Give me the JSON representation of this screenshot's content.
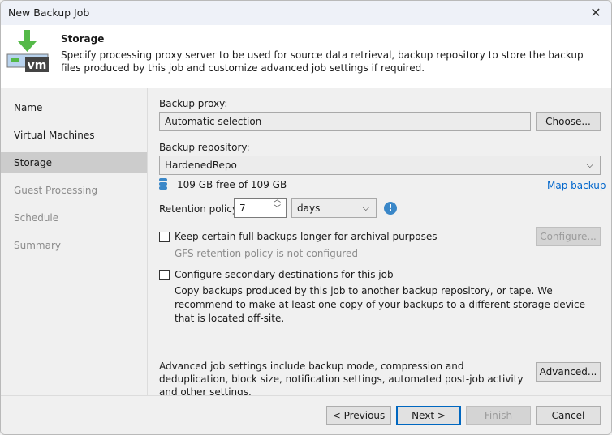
{
  "window": {
    "title": "New Backup Job",
    "close_icon": "close-icon"
  },
  "header": {
    "title": "Storage",
    "description": "Specify processing proxy server to be used for source data retrieval, backup repository to store the backup files produced by this job and customize advanced job settings if required.",
    "logo_text": "vm",
    "colors": {
      "arrow": "#54b948",
      "vm_bg": "#444444"
    }
  },
  "sidebar": {
    "items": [
      {
        "label": "Name"
      },
      {
        "label": "Virtual Machines"
      },
      {
        "label": "Storage",
        "selected": true
      },
      {
        "label": "Guest Processing",
        "disabled": true
      },
      {
        "label": "Schedule",
        "disabled": true
      },
      {
        "label": "Summary",
        "disabled": true
      }
    ]
  },
  "main": {
    "proxy_label": "Backup proxy:",
    "proxy_value": "Automatic selection",
    "choose_label": "Choose...",
    "repo_label": "Backup repository:",
    "repo_value": "HardenedRepo",
    "repo_free": "109 GB free of 109 GB",
    "map_backup": "Map backup",
    "retention_label": "Retention policy:",
    "retention_value": "7",
    "retention_unit": "days",
    "keep_label": "Keep certain full backups longer for archival purposes",
    "keep_checked": false,
    "configure_label": "Configure...",
    "gfs_status": "GFS retention policy is not configured",
    "secondary_label": "Configure secondary destinations for this job",
    "secondary_checked": false,
    "secondary_desc": "Copy backups produced by this job to another backup repository, or tape. We recommend to make at least one copy of your backups to a different storage device that is located off-site.",
    "advanced_desc": "Advanced job settings include backup mode, compression and deduplication, block size, notification settings, automated post-job activity and other settings.",
    "advanced_label": "Advanced..."
  },
  "footer": {
    "previous": "< Previous",
    "next": "Next >",
    "finish": "Finish",
    "cancel": "Cancel"
  },
  "colors": {
    "accent": "#0067c0",
    "link": "#0066cc",
    "info": "#3a87c8"
  }
}
